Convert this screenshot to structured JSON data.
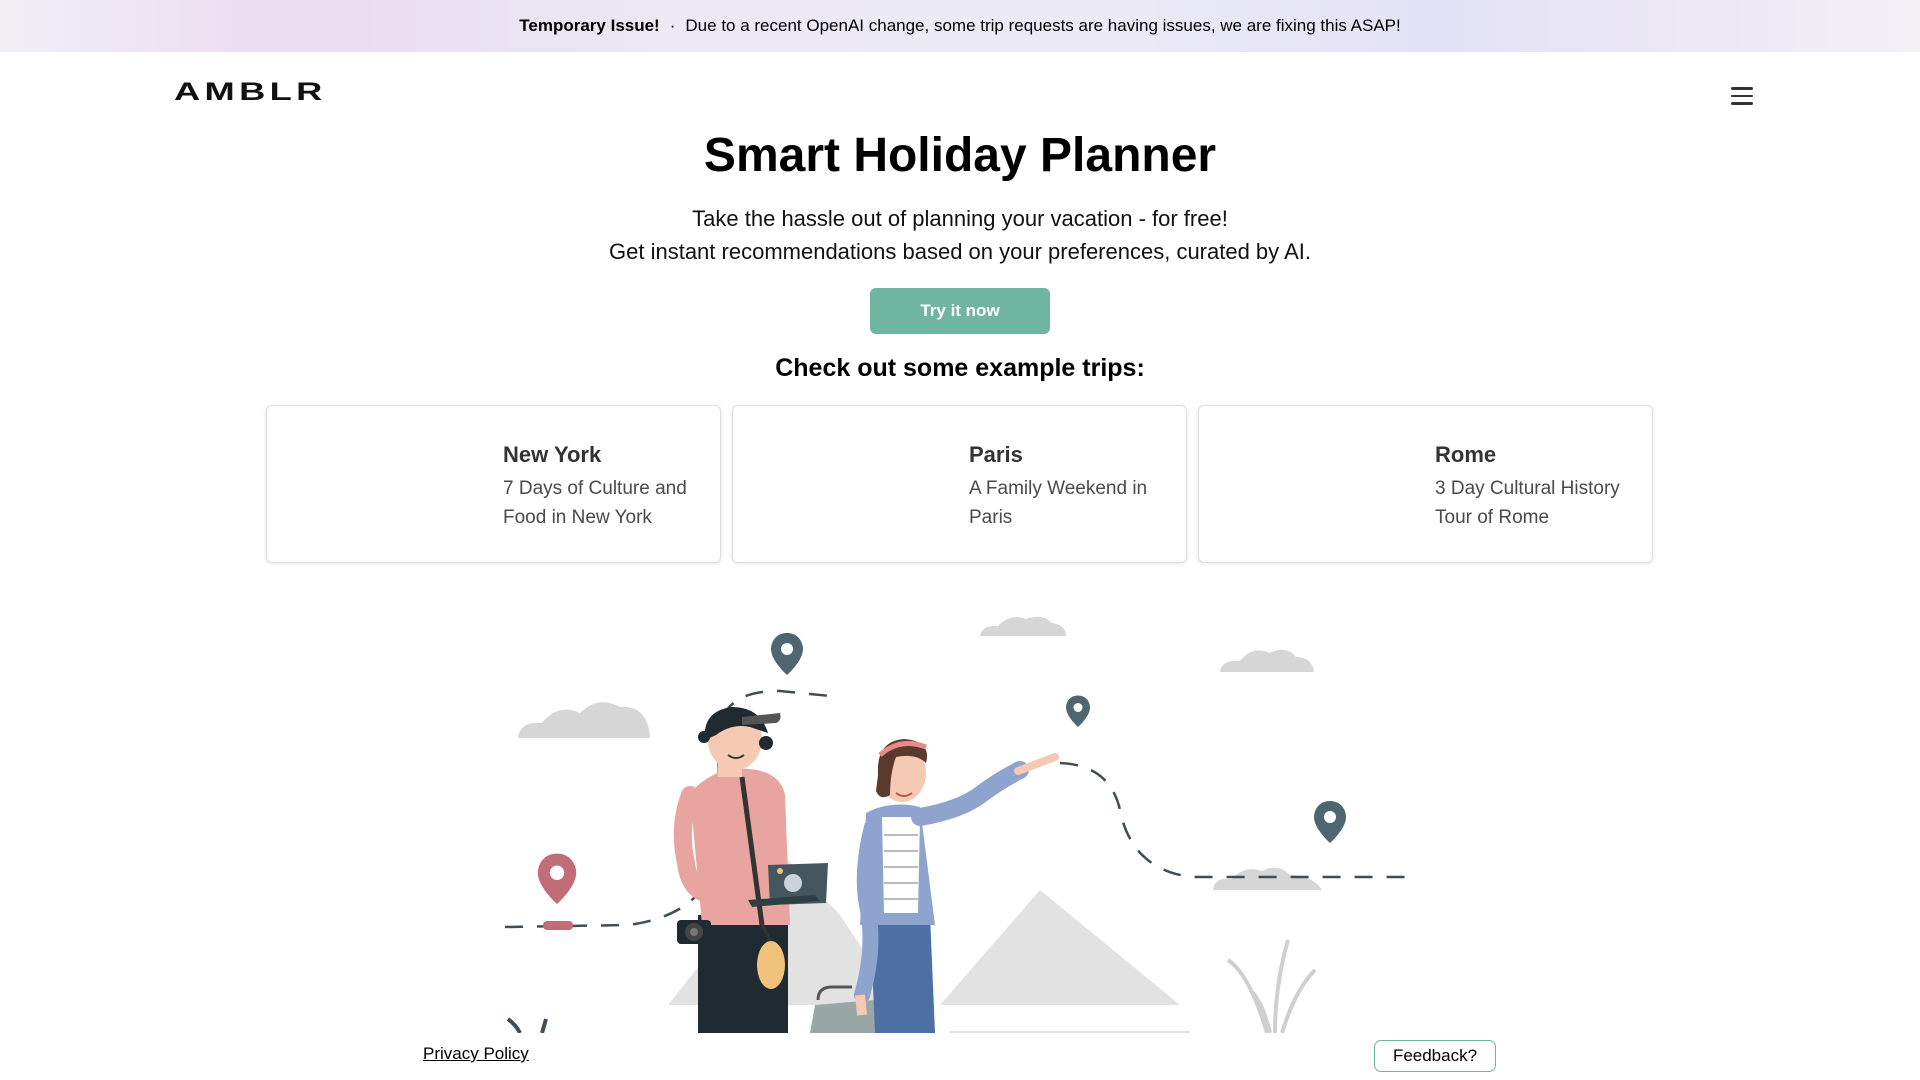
{
  "banner": {
    "label": "Temporary Issue!",
    "separator": "·",
    "message": "Due to a recent OpenAI change, some trip requests are having issues, we are fixing this ASAP!"
  },
  "header": {
    "logo": "AMBLR",
    "menu_icon": "hamburger-menu-icon"
  },
  "hero": {
    "title": "Smart Holiday Planner",
    "subtitle_line1": "Take the hassle out of planning your vacation - for free!",
    "subtitle_line2": "Get instant recommendations based on your preferences, curated by AI.",
    "cta_label": "Try it now"
  },
  "examples": {
    "heading": "Check out some example trips:",
    "trips": [
      {
        "city": "New York",
        "description": "7 Days of Culture and Food in New York"
      },
      {
        "city": "Paris",
        "description": "A Family Weekend in Paris"
      },
      {
        "city": "Rome",
        "description": "3 Day Cultural History Tour of Rome"
      }
    ]
  },
  "footer": {
    "privacy_label": "Privacy Policy",
    "feedback_label": "Feedback?"
  },
  "colors": {
    "accent": "#6fb5a0",
    "pin_dark": "#4f6670",
    "pin_red": "#c16d78",
    "cloud": "#d6d6d6"
  }
}
